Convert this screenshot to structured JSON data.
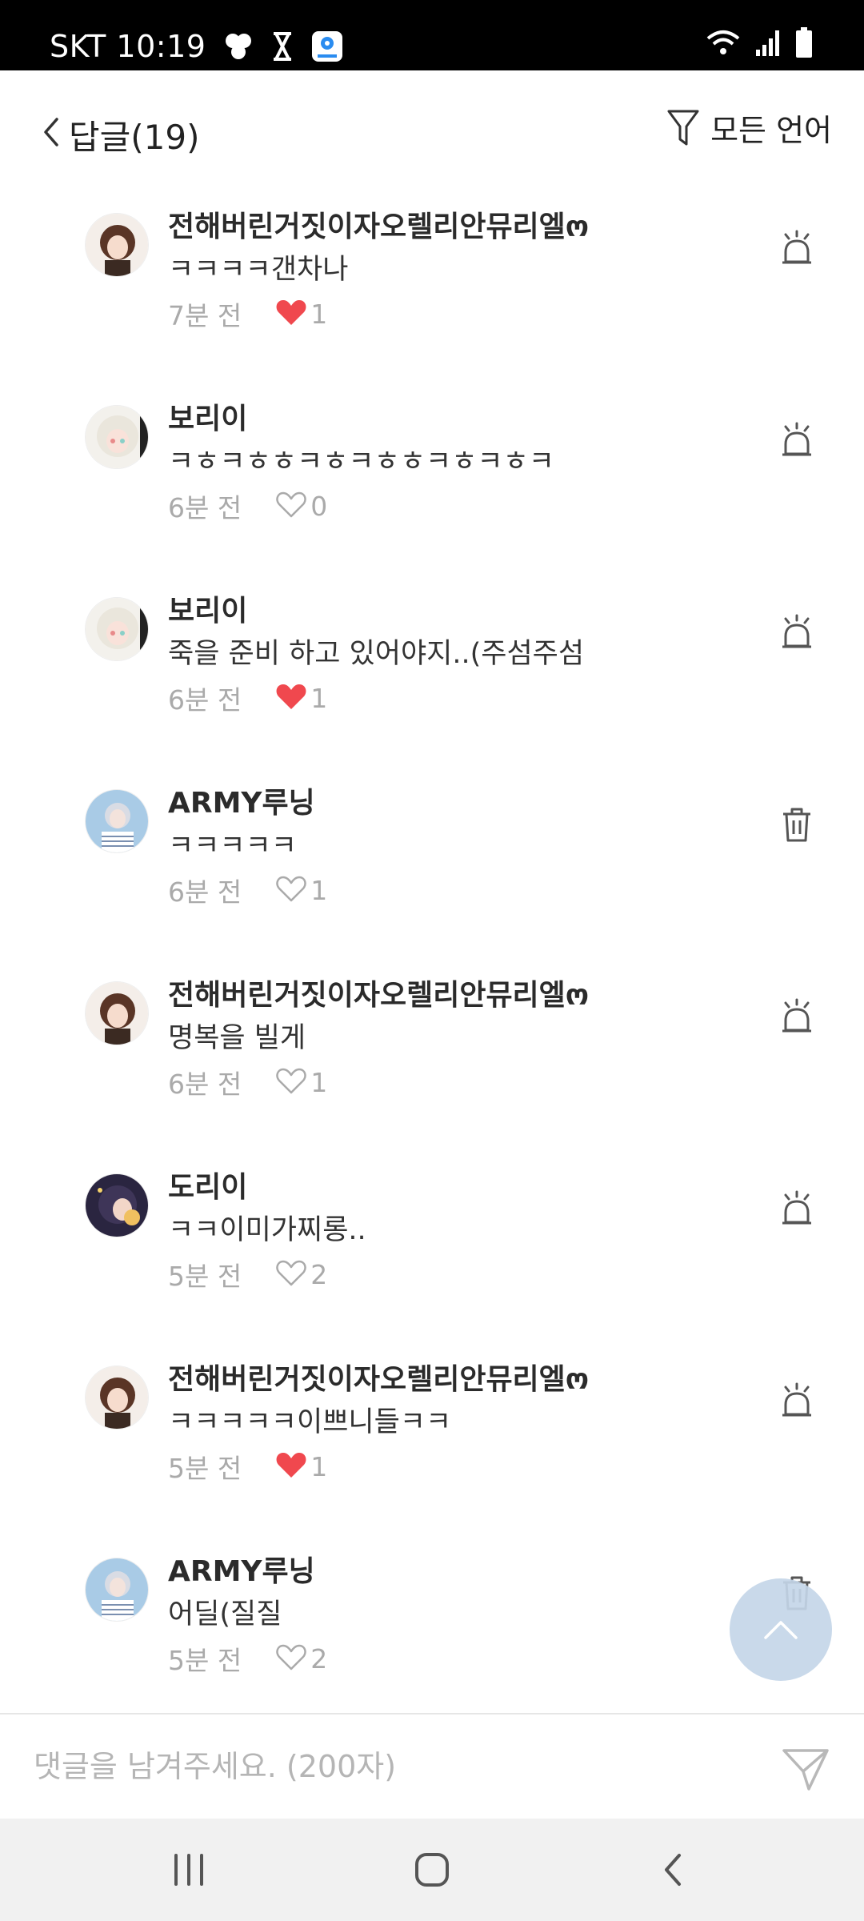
{
  "status_bar": {
    "carrier": "SKT",
    "time": "10:19",
    "icons": [
      "pinwheel-icon",
      "hourglass-icon",
      "map-app-icon",
      "wifi-icon",
      "signal-icon",
      "battery-icon"
    ]
  },
  "header": {
    "back_icon": "chevron-left-icon",
    "title": "답글(19)",
    "filter_icon": "filter-icon",
    "filter_label": "모든 언어"
  },
  "comments": [
    {
      "author": "전해버린거짓이자오렐리안뮤리엘ო",
      "text": "ㅋㅋㅋㅋ갠차나",
      "time": "7분 전",
      "liked": true,
      "likes": "1",
      "action": "report",
      "avatar": "brown"
    },
    {
      "author": "보리이",
      "text": "ㅋㅎㅋㅎㅎㅋㅎㅋㅎㅎㅋㅎㅋㅎㅋ",
      "time": "6분 전",
      "liked": false,
      "likes": "0",
      "action": "report",
      "avatar": "white"
    },
    {
      "author": "보리이",
      "text": "죽을 준비 하고 있어야지..(주섬주섬",
      "time": "6분 전",
      "liked": true,
      "likes": "1",
      "action": "report",
      "avatar": "white"
    },
    {
      "author": "ARMY루닝",
      "text": "ㅋㅋㅋㅋㅋ",
      "time": "6분 전",
      "liked": false,
      "likes": "1",
      "action": "delete",
      "avatar": "blue"
    },
    {
      "author": "전해버린거짓이자오렐리안뮤리엘ო",
      "text": "명복을 빌게",
      "time": "6분 전",
      "liked": false,
      "likes": "1",
      "action": "report",
      "avatar": "brown"
    },
    {
      "author": "도리이",
      "text": "ㅋㅋ이미가찌롱..",
      "time": "5분 전",
      "liked": false,
      "likes": "2",
      "action": "report",
      "avatar": "dark"
    },
    {
      "author": "전해버린거짓이자오렐리안뮤리엘ო",
      "text": "ㅋㅋㅋㅋㅋ이쁘니들ㅋㅋ",
      "time": "5분 전",
      "liked": true,
      "likes": "1",
      "action": "report",
      "avatar": "brown"
    },
    {
      "author": "ARMY루닝",
      "text": "어딜(질질",
      "time": "5분 전",
      "liked": false,
      "likes": "2",
      "action": "delete",
      "avatar": "blue"
    }
  ],
  "input": {
    "placeholder": "댓글을 남겨주세요. (200자)",
    "value": ""
  },
  "colors": {
    "heart_active": "#f0484e",
    "muted_text": "#aaaaaa",
    "scroll_top_bg": "#c4d6e8"
  },
  "nav": [
    "recent-apps-icon",
    "home-icon",
    "back-icon"
  ]
}
